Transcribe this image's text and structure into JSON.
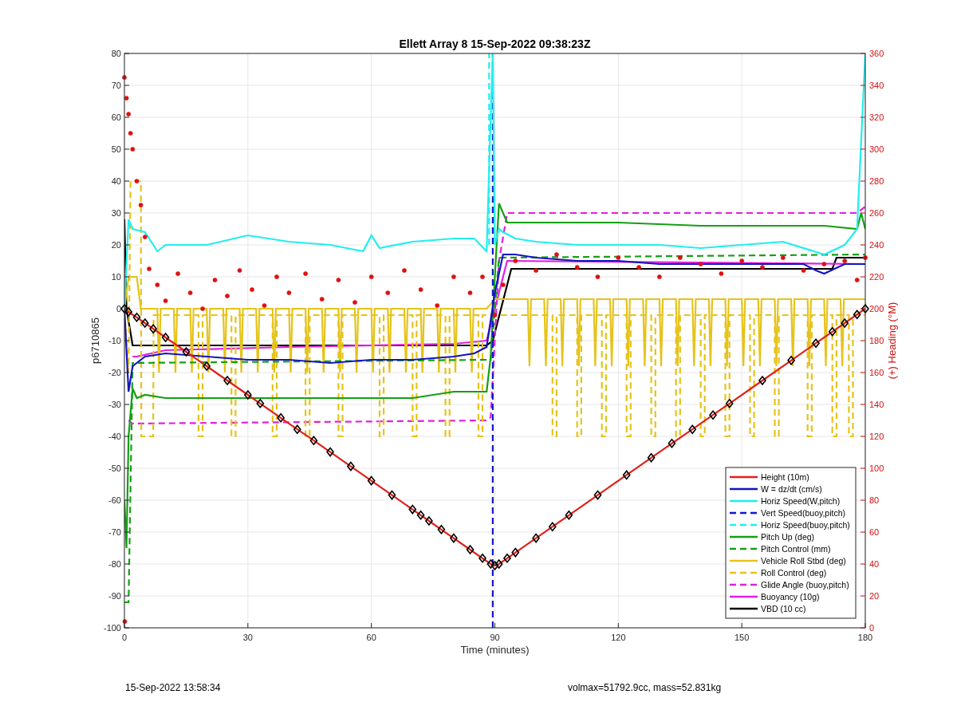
{
  "chart_data": {
    "type": "line",
    "title": "Ellett Array 8 15-Sep-2022 09:38:23Z",
    "xlabel": "Time (minutes)",
    "ylabel": "p6710865",
    "y2label": "(+) Heading (°M)",
    "xlim": [
      0,
      180
    ],
    "ylim": [
      -100,
      80
    ],
    "y2lim": [
      0,
      360
    ],
    "xticks": [
      0,
      30,
      60,
      90,
      120,
      150,
      180
    ],
    "yticks": [
      -100,
      -90,
      -80,
      -70,
      -60,
      -50,
      -40,
      -30,
      -20,
      -10,
      0,
      10,
      20,
      30,
      40,
      50,
      60,
      70,
      80
    ],
    "y2ticks": [
      0,
      20,
      40,
      60,
      80,
      100,
      120,
      140,
      160,
      180,
      200,
      220,
      240,
      260,
      280,
      300,
      320,
      340,
      360
    ],
    "series": [
      {
        "name": "Height (10m)",
        "color": "#e0201a",
        "line_style": "solid",
        "marker": "diamond",
        "x": [
          0,
          1,
          3,
          5,
          7,
          10,
          15,
          20,
          25,
          30,
          33,
          38,
          42,
          46,
          50,
          55,
          60,
          65,
          70,
          72,
          74,
          77,
          80,
          84,
          87,
          89,
          90,
          91,
          93,
          95,
          100,
          104,
          108,
          115,
          122,
          128,
          133,
          138,
          143,
          147,
          155,
          162,
          168,
          172,
          175,
          178,
          180
        ],
        "values": [
          0,
          -1,
          -2.7,
          -4.5,
          -6.3,
          -9,
          -13.5,
          -18,
          -22.5,
          -27,
          -29.7,
          -34.2,
          -37.8,
          -41.3,
          -44.9,
          -49.4,
          -53.9,
          -58.4,
          -62.9,
          -64.7,
          -66.5,
          -69.2,
          -71.9,
          -75.5,
          -78.2,
          -80,
          -80.5,
          -80,
          -78.2,
          -76.4,
          -71.9,
          -68.3,
          -64.7,
          -58.4,
          -52.1,
          -46.7,
          -42.2,
          -37.8,
          -33.3,
          -29.7,
          -22.5,
          -16.2,
          -10.8,
          -7.2,
          -4.5,
          -1.8,
          0
        ]
      },
      {
        "name": "W = dz/dt (cm/s)",
        "color": "#1414c0",
        "x": [
          0,
          1,
          2,
          5,
          10,
          20,
          30,
          40,
          50,
          60,
          70,
          80,
          85,
          88,
          90,
          92,
          95,
          100,
          110,
          120,
          130,
          140,
          150,
          160,
          165,
          168,
          170,
          175,
          180
        ],
        "values": [
          0,
          -26,
          -18,
          -15,
          -14,
          -15,
          -16,
          -16,
          -17,
          -16,
          -16,
          -15,
          -14,
          -12,
          5,
          17,
          17,
          16,
          15,
          15,
          14,
          14,
          14,
          14,
          14,
          12,
          11,
          14,
          14
        ]
      },
      {
        "name": "Horiz Speed(W,pitch)",
        "color": "#22eeee",
        "x": [
          0,
          1,
          2,
          5,
          8,
          10,
          20,
          30,
          40,
          50,
          58,
          60,
          62,
          70,
          80,
          85,
          88,
          89,
          89.5,
          90,
          91,
          92,
          95,
          100,
          110,
          120,
          130,
          140,
          150,
          160,
          170,
          175,
          178,
          180
        ],
        "values": [
          0,
          28,
          25,
          24,
          18,
          20,
          20,
          23,
          21,
          20,
          18,
          23,
          19,
          21,
          22,
          22,
          18,
          60,
          80,
          20,
          25,
          24,
          22,
          21,
          20,
          20,
          20,
          19,
          20,
          21,
          17,
          20,
          25,
          80
        ]
      },
      {
        "name": "Vert Speed(buoy,pitch)",
        "color": "#1414d0",
        "line_style": "dashed",
        "x": [
          89.5,
          89.5
        ],
        "values": [
          -100,
          80
        ]
      },
      {
        "name": "Horiz Speed(buoy,pitch)",
        "color": "#22eeee",
        "line_style": "dashed",
        "x": [
          88.6,
          88.6
        ],
        "values": [
          20,
          80
        ]
      },
      {
        "name": "Pitch Up (deg)",
        "color": "#14a014",
        "x": [
          0,
          0.5,
          1,
          2,
          3,
          5,
          10,
          20,
          30,
          40,
          50,
          60,
          70,
          80,
          88,
          89,
          90,
          91,
          92,
          93,
          95,
          100,
          120,
          140,
          160,
          170,
          178,
          179,
          180
        ],
        "values": [
          -60,
          -75,
          -40,
          -25,
          -28,
          -27,
          -28,
          -28,
          -28,
          -28,
          -28,
          -28,
          -28,
          -26,
          -26,
          -15,
          10,
          33,
          30,
          27,
          27,
          27,
          27,
          26,
          26,
          26,
          25,
          30,
          25
        ]
      },
      {
        "name": "Pitch Control (mm)",
        "color": "#14a014",
        "line_style": "dashed",
        "x": [
          0,
          1,
          2,
          88,
          89,
          91,
          180
        ],
        "values": [
          -92,
          -92,
          -17,
          -16,
          -16,
          16,
          17
        ]
      },
      {
        "name": "Vehicle Roll Stbd (deg)",
        "color": "#e6c31a",
        "x": [
          0,
          1,
          3,
          4,
          8,
          8.4,
          8.8,
          12,
          12.4,
          12.8,
          16,
          16.4,
          16.8,
          20,
          20.4,
          20.8,
          24,
          24.4,
          24.8,
          28,
          28.4,
          28.8,
          32,
          32.4,
          32.8,
          36,
          36.4,
          36.8,
          40,
          40.4,
          40.8,
          44,
          44.4,
          44.8,
          48,
          48.4,
          48.8,
          52,
          52.4,
          52.8,
          56,
          56.4,
          56.8,
          60,
          60.4,
          60.8,
          64,
          64.4,
          64.8,
          68,
          68.4,
          68.8,
          72,
          72.4,
          72.8,
          76,
          76.4,
          76.8,
          80,
          80.4,
          80.8,
          84,
          84.4,
          84.8,
          88,
          90,
          92,
          98,
          98.4,
          98.8,
          102,
          102.4,
          102.8,
          106,
          106.4,
          106.8,
          110,
          110.4,
          110.8,
          114,
          114.4,
          114.8,
          118,
          118.4,
          118.8,
          122,
          122.4,
          122.8,
          126,
          126.4,
          126.8,
          130,
          130.4,
          130.8,
          134,
          134.4,
          134.8,
          138,
          138.4,
          138.8,
          142,
          142.4,
          142.8,
          146,
          146.4,
          146.8,
          150,
          150.4,
          150.8,
          154,
          154.4,
          154.8,
          158,
          158.4,
          158.8,
          162,
          162.4,
          162.8,
          166,
          166.4,
          166.8,
          170,
          170.4,
          170.8,
          174,
          174.4,
          174.8,
          180
        ],
        "values": [
          0,
          10,
          10,
          0,
          0,
          -20,
          0,
          0,
          -20,
          0,
          0,
          -20,
          0,
          0,
          -20,
          0,
          0,
          -20,
          0,
          0,
          -20,
          0,
          0,
          -20,
          0,
          0,
          -20,
          0,
          0,
          -20,
          0,
          0,
          -20,
          0,
          0,
          -20,
          0,
          0,
          -20,
          0,
          0,
          -20,
          0,
          0,
          -20,
          0,
          0,
          -20,
          0,
          0,
          -20,
          0,
          0,
          -20,
          0,
          0,
          -20,
          0,
          0,
          -20,
          0,
          0,
          -20,
          0,
          0,
          3,
          3,
          3,
          -18,
          3,
          3,
          -18,
          3,
          3,
          -18,
          3,
          3,
          -18,
          3,
          3,
          -18,
          3,
          3,
          -18,
          3,
          3,
          -18,
          3,
          3,
          -18,
          3,
          3,
          -18,
          3,
          3,
          -18,
          3,
          3,
          -18,
          3,
          3,
          -18,
          3,
          3,
          -18,
          3,
          3,
          -18,
          3,
          3,
          -18,
          3,
          3,
          -18,
          3,
          3,
          -18,
          3,
          3,
          -18,
          3,
          3,
          -18,
          3,
          3,
          -18,
          3,
          3
        ]
      },
      {
        "name": "Roll Control (deg)",
        "color": "#e6c31a",
        "line_style": "dashed",
        "x": [
          0,
          1,
          1.5,
          4,
          4.1,
          7,
          7.1,
          18,
          18,
          19,
          19,
          26,
          26,
          27,
          27,
          36,
          36,
          37,
          37,
          44,
          44,
          45,
          45,
          52,
          52,
          53,
          53,
          62,
          62,
          63,
          63,
          70,
          70,
          71,
          71,
          78,
          78,
          79,
          79,
          86,
          86,
          87,
          87,
          90,
          104,
          104,
          105,
          105,
          110,
          110,
          111,
          111,
          116,
          116,
          117,
          117,
          122,
          122,
          123,
          123,
          128,
          128,
          129,
          129,
          134,
          134,
          135,
          135,
          140,
          140,
          141,
          141,
          146,
          146,
          147,
          147,
          152,
          152,
          153,
          153,
          158,
          158,
          159,
          159,
          166,
          166,
          167,
          167,
          172,
          172,
          173,
          173,
          176,
          176,
          177,
          177,
          180
        ],
        "values": [
          0,
          -20,
          40,
          40,
          -40,
          -40,
          -2,
          -2,
          -40,
          -40,
          -2,
          -2,
          -40,
          -40,
          -2,
          -2,
          -40,
          -40,
          -2,
          -2,
          -40,
          -40,
          -2,
          -2,
          -40,
          -40,
          -2,
          -2,
          -40,
          -40,
          -2,
          -2,
          -40,
          -40,
          -2,
          -2,
          -40,
          -40,
          -2,
          -2,
          -40,
          -40,
          -2,
          -2,
          -2,
          -40,
          -40,
          -2,
          -2,
          -40,
          -40,
          -2,
          -2,
          -40,
          -40,
          -2,
          -2,
          -40,
          -40,
          -2,
          -2,
          -40,
          -40,
          -2,
          -2,
          -40,
          -40,
          -2,
          -2,
          -40,
          -40,
          -2,
          -2,
          -40,
          -40,
          -2,
          -2,
          -40,
          -40,
          -2,
          -2,
          -40,
          -40,
          -2,
          -2,
          -40,
          -40,
          -2,
          -2,
          -40,
          -40,
          -2,
          -2,
          -40,
          -40,
          -2,
          -2
        ]
      },
      {
        "name": "Glide Angle (buoy,pitch)",
        "color": "#e020e0",
        "line_style": "dashed",
        "x": [
          1,
          2,
          88,
          89,
          91,
          93,
          178,
          180
        ],
        "values": [
          -35,
          -36,
          -35,
          -34,
          15,
          30,
          30,
          32
        ]
      },
      {
        "name": "Buoyancy (10g)",
        "color": "#e020e0",
        "x": [
          2,
          3,
          10,
          40,
          80,
          88,
          92,
          93,
          180
        ],
        "values": [
          -15,
          -15,
          -13,
          -12,
          -11,
          -10,
          10,
          15,
          14
        ]
      },
      {
        "name": "VBD (10 cc)",
        "color": "#000000",
        "x": [
          0,
          0.5,
          2,
          88,
          89.5,
          94,
          172,
          173,
          180
        ],
        "values": [
          28,
          0,
          -11.5,
          -11.5,
          -10,
          12.5,
          12.5,
          16,
          16
        ]
      },
      {
        "color": "#e01010",
        "axis": "y2",
        "type": "scatter",
        "x": [
          0,
          0.1,
          0.5,
          1,
          1.5,
          2,
          3,
          4,
          5,
          6,
          8,
          10,
          13,
          16,
          19,
          22,
          25,
          28,
          31,
          34,
          37,
          40,
          44,
          48,
          52,
          56,
          60,
          64,
          68,
          72,
          76,
          80,
          84,
          87,
          90,
          92,
          95,
          100,
          105,
          110,
          115,
          120,
          125,
          130,
          135,
          140,
          145,
          150,
          155,
          160,
          165,
          170,
          175,
          178,
          180
        ],
        "values": [
          345,
          4,
          332,
          322,
          310,
          300,
          280,
          265,
          245,
          225,
          215,
          205,
          222,
          210,
          200,
          218,
          208,
          224,
          212,
          202,
          220,
          210,
          222,
          206,
          218,
          204,
          220,
          210,
          224,
          212,
          202,
          220,
          210,
          220,
          196,
          215,
          230,
          224,
          234,
          226,
          220,
          232,
          226,
          220,
          232,
          228,
          222,
          230,
          226,
          232,
          224,
          228,
          230,
          218,
          232
        ]
      }
    ],
    "grid": true,
    "legend": true
  },
  "footer": {
    "timestamp": "15-Sep-2022 13:58:34",
    "summary": "volmax=51792.9cc, mass=52.831kg"
  }
}
